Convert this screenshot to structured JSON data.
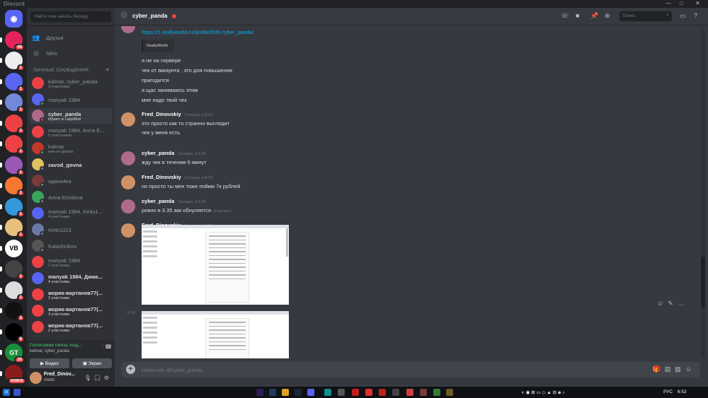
{
  "window": {
    "app_name": "Discord",
    "controls": [
      "—",
      "□",
      "✕"
    ]
  },
  "servers": [
    {
      "label": "",
      "color": "#5865f2",
      "badge": "",
      "icon": "discord-home-icon"
    },
    {
      "label": "",
      "color": "#e3245a",
      "badge": "48"
    },
    {
      "label": "",
      "color": "#eeeeee",
      "badge": "1"
    },
    {
      "label": "",
      "color": "#5865f2",
      "badge": "1"
    },
    {
      "label": "",
      "color": "#7289da",
      "badge": "1"
    },
    {
      "label": "",
      "color": "#ed4245",
      "badge": "1"
    },
    {
      "label": "",
      "color": "#ed4245",
      "badge": "1"
    },
    {
      "label": "",
      "color": "#9b59b6",
      "badge": "1"
    },
    {
      "label": "",
      "color": "#f57731",
      "badge": "1"
    },
    {
      "label": "",
      "color": "#3498db",
      "badge": "1"
    },
    {
      "label": "",
      "color": "#e8c07d",
      "badge": "1"
    },
    {
      "label": "VB",
      "color": "#ffffff",
      "badge": ""
    },
    {
      "label": "",
      "color": "#444444",
      "badge": "1"
    },
    {
      "label": "",
      "color": "#dddddd",
      "badge": "1"
    },
    {
      "label": "",
      "color": "#111111",
      "badge": "2"
    },
    {
      "label": "",
      "color": "#000000",
      "badge": "6"
    },
    {
      "label": "GT",
      "color": "#1a8f3c",
      "badge": "30"
    },
    {
      "label": "",
      "color": "#8b1c1c",
      "badge": "НОВОЕ"
    }
  ],
  "sidebar": {
    "search_placeholder": "Найти или начать беседу",
    "friends_label": "Друзья",
    "nitro_label": "Nitro",
    "dm_header": "ЛИЧНЫЕ СООБЩЕНИЯ",
    "dms": [
      {
        "name": "kalmar, cyber_panda",
        "sub": "3 участника",
        "color": "#ed4245",
        "status": ""
      },
      {
        "name": "manyak 1984",
        "sub": "",
        "color": "#5865f2",
        "status": "#3ba55d"
      },
      {
        "name": "cyber_panda",
        "sub": "Играет в LabyMod",
        "color": "#b06b8a",
        "status": "#ed4245",
        "active": true
      },
      {
        "name": "manyak 1984, Anna E...",
        "sub": "5 участников",
        "color": "#ed4245",
        "status": ""
      },
      {
        "name": "kalmar",
        "sub": "мне не делаю",
        "color": "#c0392b",
        "status": "#3ba55d"
      },
      {
        "name": "zavod_govna",
        "sub": "",
        "color": "#e0c060",
        "status": "#747f8d",
        "bright": true
      },
      {
        "name": "одино4ка",
        "sub": "",
        "color": "#7a3a3a",
        "status": "#747f8d"
      },
      {
        "name": "Anna Ermilova",
        "sub": "",
        "color": "#3ba55d",
        "status": "#747f8d"
      },
      {
        "name": "manyak 1984, Kirito1...",
        "sub": "4 участника",
        "color": "#5865f2",
        "status": ""
      },
      {
        "name": "Kirito1113",
        "sub": "",
        "color": "#6a7aa8",
        "status": "#747f8d"
      },
      {
        "name": "Kalashnikov",
        "sub": "",
        "color": "#555555",
        "status": "#747f8d"
      },
      {
        "name": "manyak 1984",
        "sub": "2 участника",
        "color": "#ed4245",
        "status": ""
      },
      {
        "name": "manyak 1984, Дима...",
        "sub": "4 участника",
        "color": "#5865f2",
        "status": "",
        "bright": true
      },
      {
        "name": "жорик-вартанов77(...",
        "sub": "2 участника",
        "color": "#ed4245",
        "status": "",
        "bright": true
      },
      {
        "name": "жорик-вартанов77(...",
        "sub": "3 участника",
        "color": "#ed4245",
        "status": "",
        "bright": true
      },
      {
        "name": "жорик-вартанов77(...",
        "sub": "2 участника",
        "color": "#ed4245",
        "status": "",
        "bright": true
      }
    ],
    "voice": {
      "status": "Голосовая связь под...",
      "channel": "kalmar, cyber_panda",
      "video": "Видео",
      "screen": "Экран"
    },
    "user": {
      "name": "Fred_Dinov...",
      "tag": "#6880"
    }
  },
  "header": {
    "name": "cyber_panda",
    "search_placeholder": "Поиск"
  },
  "messages": {
    "link": "https://1.reallyworld.ru/profile/609-cyber_panda/",
    "embed_label": "ReallyWorld",
    "panda_lines": [
      "я не на сервере",
      "чек от аккаунта , это для повышения",
      "пригодится",
      "я щас занимаюсь этим",
      "мне надо твой чек"
    ],
    "groups": [
      {
        "author": "Fred_Dinovskiy",
        "time": "Сегодня, в 6:29",
        "lines": [
          "это просто как то странно выглядит",
          "чек у меня есть"
        ],
        "color": "#d19166"
      },
      {
        "author": "cyber_panda",
        "time": "Сегодня, в 6:29",
        "lines": [
          "жду чек в течении 6 минут"
        ],
        "color": "#b06b8a"
      },
      {
        "author": "Fred_Dinovskiy",
        "time": "Сегодня, в 6:29",
        "lines": [
          "но просто ты мен тоже пойми 7к рублей"
        ],
        "color": "#d19166"
      },
      {
        "author": "cyber_panda",
        "time": "Сегодня, в 6:29",
        "lines": [
          "ровно в 3.35 акк обнуляется"
        ],
        "edited": "(изменено)",
        "color": "#b06b8a"
      },
      {
        "author": "Fred_Dinovskiy",
        "time": "Сегодня, в 6:30",
        "lines": [],
        "color": "#d19166"
      }
    ],
    "side_time": "6:30"
  },
  "composer": {
    "placeholder": "Написать @cyber_panda"
  },
  "taskbar": {
    "lang": "РУС",
    "clock": "6:52"
  }
}
